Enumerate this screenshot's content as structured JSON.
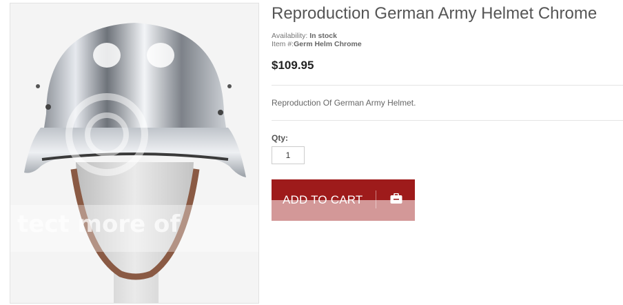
{
  "product": {
    "title": "Reproduction German Army Helmet Chrome",
    "availability_label": "Availability:",
    "availability_value": "In stock",
    "item_label": "Item #:",
    "item_value": "Germ Helm Chrome",
    "price": "$109.95",
    "description": "Reproduction Of German Army Helmet.",
    "qty_label": "Qty:",
    "qty_value": "1",
    "add_to_cart_label": "ADD TO CART",
    "cart_icon": "shopping-bag-icon",
    "image_alt": "Chrome German army helmet on mannequin head",
    "image_watermark": "tect more of"
  },
  "colors": {
    "button": "#9e1b1b",
    "title": "#555555",
    "price": "#222222"
  }
}
